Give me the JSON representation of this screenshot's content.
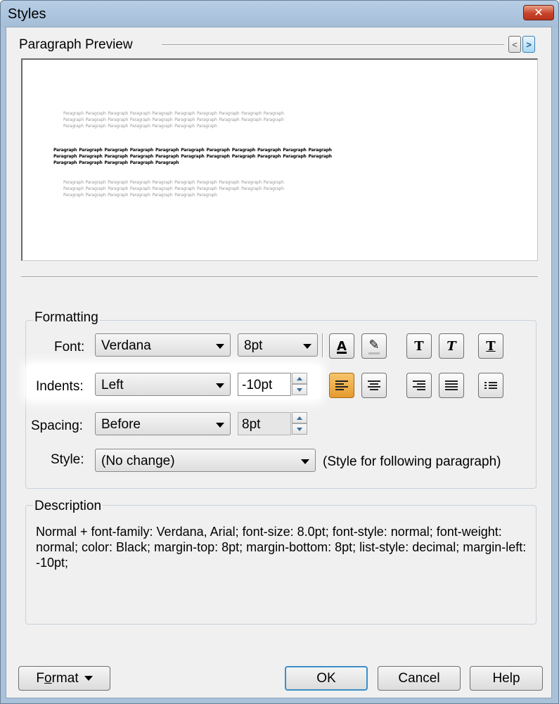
{
  "window": {
    "title": "Styles",
    "close_glyph": "✕"
  },
  "preview": {
    "label": "Paragraph Preview",
    "prev_glyph": "<",
    "next_glyph": ">",
    "before_lines": [
      "Paragraph Paragraph Paragraph Paragraph Paragraph Paragraph Paragraph Paragraph Paragraph Paragraph",
      "Paragraph Paragraph Paragraph Paragraph Paragraph Paragraph Paragraph Paragraph Paragraph Paragraph",
      "Paragraph Paragraph Paragraph Paragraph Paragraph Paragraph Paragraph"
    ],
    "current_lines": [
      "Paragraph Paragraph Paragraph Paragraph Paragraph Paragraph Paragraph Paragraph Paragraph Paragraph Paragraph",
      "Paragraph Paragraph Paragraph Paragraph Paragraph Paragraph Paragraph Paragraph Paragraph Paragraph Paragraph",
      "Paragraph Paragraph Paragraph Paragraph Paragraph"
    ],
    "after_lines": [
      "Paragraph Paragraph Paragraph Paragraph Paragraph Paragraph Paragraph Paragraph Paragraph Paragraph",
      "Paragraph Paragraph Paragraph Paragraph Paragraph Paragraph Paragraph Paragraph Paragraph Paragraph",
      "Paragraph Paragraph Paragraph Paragraph Paragraph Paragraph Paragraph"
    ]
  },
  "formatting": {
    "group_label": "Formatting",
    "font_label": "Font:",
    "font_value": "Verdana",
    "font_size_value": "8pt",
    "indents_label": "Indents:",
    "indents_value": "Left",
    "indent_amount": "-10pt",
    "spacing_label": "Spacing:",
    "spacing_value": "Before",
    "spacing_amount": "8pt",
    "style_label": "Style:",
    "style_value": "(No change)",
    "style_hint": "(Style for following paragraph)",
    "text_buttons": [
      {
        "name": "font-color-icon",
        "glyph": "A"
      },
      {
        "name": "highlight-pen-icon",
        "glyph": "✎"
      },
      {
        "name": "bold-t-icon",
        "glyph": "T"
      },
      {
        "name": "italic-t-icon",
        "glyph": "T"
      },
      {
        "name": "underline-t-icon",
        "glyph": "T"
      }
    ],
    "align_buttons": [
      "align-left-icon",
      "align-center-icon",
      "align-right-icon",
      "align-justify-icon",
      "list-icon"
    ],
    "active_align": "align-left-icon",
    "accent_color": "#e8a23c"
  },
  "description": {
    "group_label": "Description",
    "text": "Normal + font-family: Verdana, Arial;  font-size: 8.0pt;  font-style: normal;  font-weight: normal;  color: Black;  margin-top: 8pt;  margin-bottom: 8pt;  list-style: decimal;  margin-left: -10pt;"
  },
  "buttons": {
    "format_prefix": "F",
    "format_mnemonic": "o",
    "format_suffix": "rmat",
    "ok": "OK",
    "cancel": "Cancel",
    "help": "Help"
  }
}
